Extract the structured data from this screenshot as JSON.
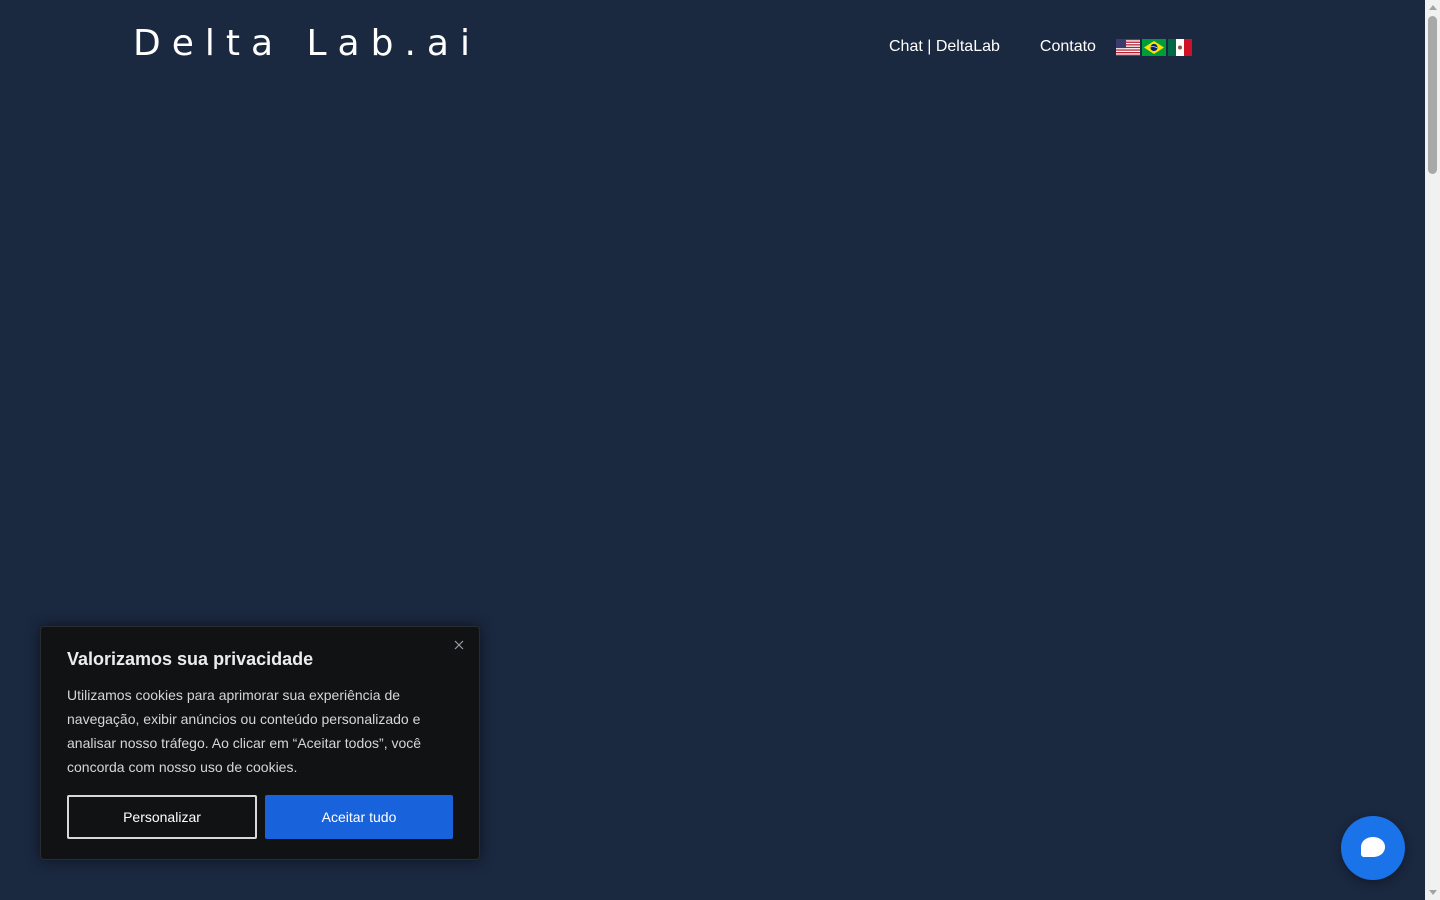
{
  "header": {
    "logo_text": "Delta Lab.ai",
    "nav": {
      "chat_label": "Chat | DeltaLab",
      "contact_label": "Contato"
    },
    "languages": [
      "flag-us",
      "flag-brazil",
      "flag-mexico"
    ]
  },
  "cookie_banner": {
    "title": "Valorizamos sua privacidade",
    "body": "Utilizamos cookies para aprimorar sua experiência de navegação, exibir anúncios ou conteúdo personalizado e analisar nosso tráfego. Ao clicar em “Aceitar todos”, você concorda com nosso uso de cookies.",
    "customize_label": "Personalizar",
    "accept_label": "Aceitar tudo",
    "close_icon": "close-icon"
  },
  "chat_widget": {
    "icon": "chat-bubble-icon"
  },
  "colors": {
    "page_background": "#1a2840",
    "banner_background": "#111214",
    "accent_blue": "#1863dc",
    "chat_blue": "#1a73e8"
  }
}
